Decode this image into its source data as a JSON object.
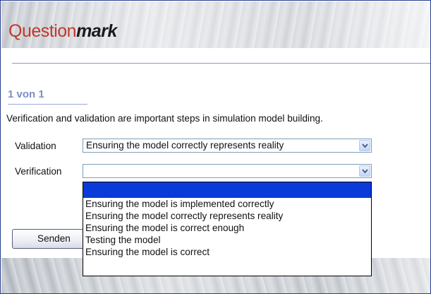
{
  "header": {
    "logo_part1": "Question",
    "logo_part2": "mark"
  },
  "page_label": "1 von 1",
  "question": "Verification and validation are important steps in simulation model building.",
  "rows": [
    {
      "label": "Validation",
      "selected": "Ensuring the model correctly represents reality"
    },
    {
      "label": "Verification",
      "selected": ""
    }
  ],
  "dropdown": {
    "options": [
      "",
      "Ensuring the model is implemented correctly",
      "Ensuring the model correctly represents reality",
      "Ensuring the model is correct enough",
      "Testing the model",
      "Ensuring the model is correct"
    ],
    "highlighted_index": 0
  },
  "send_button": {
    "label": "Senden"
  },
  "colors": {
    "accent": "#7a8fc4",
    "logo_red": "#c0392b",
    "selection": "#0a3bd8",
    "border": "#2b3f8f"
  },
  "icons": {
    "dropdown_arrow": "chevron-down-icon"
  }
}
